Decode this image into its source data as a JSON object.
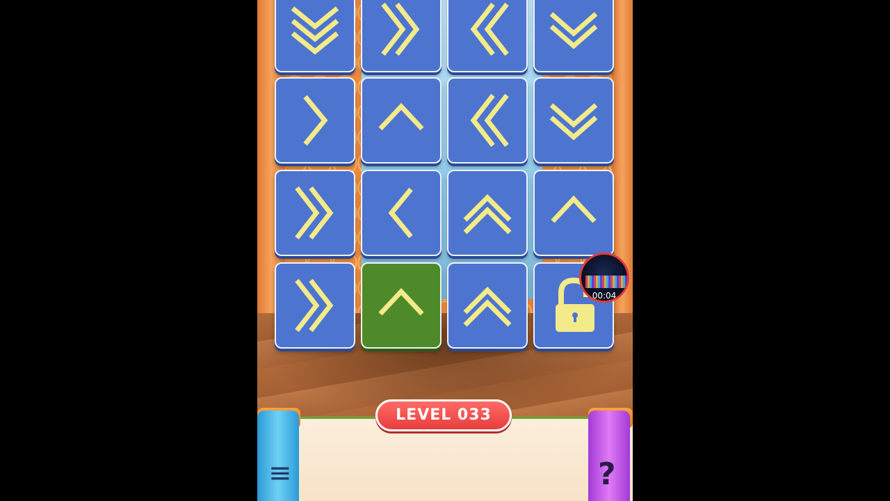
{
  "level": {
    "label": "LEVEL 033"
  },
  "timer": {
    "text": "00:04"
  },
  "tiles": [
    {
      "id": "r1c1",
      "icon": "triple-chevron-down-icon",
      "color": "blue"
    },
    {
      "id": "r1c2",
      "icon": "double-chevron-right-icon",
      "color": "blue"
    },
    {
      "id": "r1c3",
      "icon": "double-chevron-left-icon",
      "color": "blue"
    },
    {
      "id": "r1c4",
      "icon": "double-chevron-down-icon",
      "color": "blue"
    },
    {
      "id": "r2c1",
      "icon": "chevron-right-icon",
      "color": "blue"
    },
    {
      "id": "r2c2",
      "icon": "chevron-up-icon",
      "color": "blue"
    },
    {
      "id": "r2c3",
      "icon": "double-chevron-left-icon",
      "color": "blue"
    },
    {
      "id": "r2c4",
      "icon": "double-chevron-down-icon",
      "color": "blue"
    },
    {
      "id": "r3c1",
      "icon": "double-chevron-right-icon",
      "color": "blue"
    },
    {
      "id": "r3c2",
      "icon": "chevron-left-icon",
      "color": "blue"
    },
    {
      "id": "r3c3",
      "icon": "double-chevron-up-icon",
      "color": "blue"
    },
    {
      "id": "r3c4",
      "icon": "chevron-up-icon",
      "color": "blue"
    },
    {
      "id": "r4c1",
      "icon": "double-chevron-right-icon",
      "color": "blue"
    },
    {
      "id": "r4c2",
      "icon": "chevron-up-icon",
      "color": "green"
    },
    {
      "id": "r4c3",
      "icon": "double-chevron-up-icon",
      "color": "blue"
    },
    {
      "id": "r4c4",
      "icon": "padlock-open-icon",
      "color": "blue"
    }
  ],
  "buttons": {
    "menu_icon": "menu-icon",
    "help_icon": "question-mark-icon",
    "help_glyph": "?",
    "menu_glyph": "≡"
  },
  "colors": {
    "tile_blue": "#4d74cf",
    "tile_green": "#4f8a2a",
    "arrow_yellow": "#f3ea8a",
    "level_red": "#e63e3e"
  }
}
